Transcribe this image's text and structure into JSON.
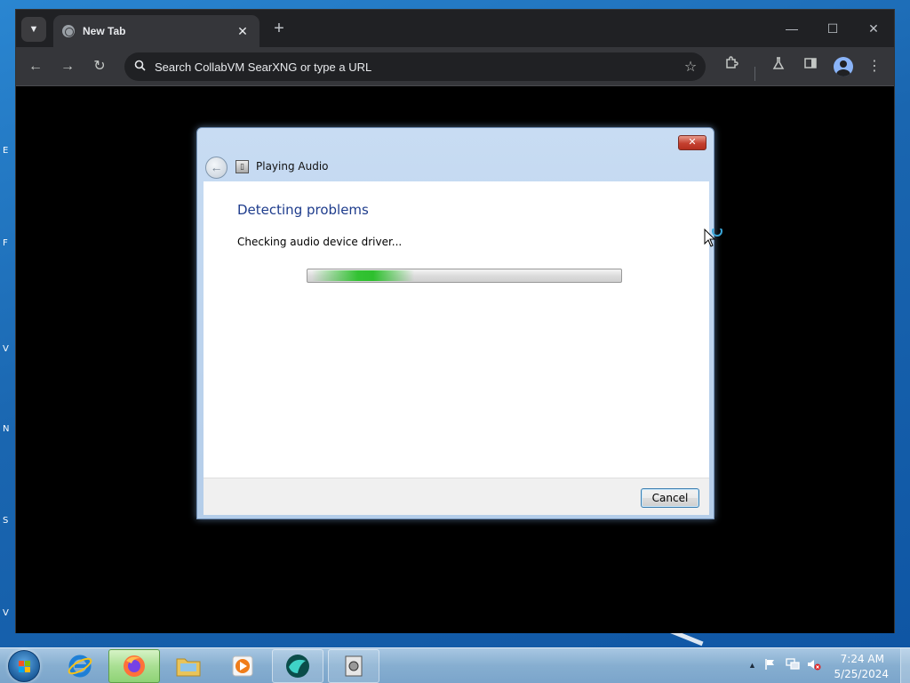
{
  "browser": {
    "tab": {
      "title": "New Tab",
      "close_glyph": "✕"
    },
    "new_tab_glyph": "+",
    "window_controls": {
      "minimize": "—",
      "maximize": "☐",
      "close": "✕"
    },
    "nav": {
      "back": "←",
      "forward": "→",
      "reload": "↻"
    },
    "omnibox": {
      "placeholder": "Search CollabVM SearXNG or type a URL",
      "value": ""
    },
    "toolbar_icons": [
      "extensions-icon",
      "labs-icon",
      "side-panel-icon",
      "profile-icon",
      "menu-icon"
    ]
  },
  "dialog": {
    "title": "Playing Audio",
    "close_glyph": "✕",
    "heading": "Detecting problems",
    "status": "Checking audio device driver...",
    "progress": {
      "mode": "indeterminate",
      "color": "#33c233"
    },
    "cancel_label": "Cancel"
  },
  "desktop": {
    "edge_letters": [
      "E",
      "F",
      "V",
      "N",
      "S",
      "V"
    ]
  },
  "taskbar": {
    "apps": [
      {
        "name": "internet-explorer",
        "state": "pinned"
      },
      {
        "name": "firefox",
        "state": "active"
      },
      {
        "name": "file-explorer",
        "state": "pinned"
      },
      {
        "name": "media-player",
        "state": "pinned"
      },
      {
        "name": "browser",
        "state": "open"
      },
      {
        "name": "troubleshooter",
        "state": "open"
      }
    ],
    "tray": {
      "show_hidden": "▲",
      "time": "7:24 AM",
      "date": "5/25/2024"
    }
  },
  "colors": {
    "browser_chrome": "#202124",
    "toolbar": "#35363a",
    "dialog_heading": "#1e3c8c",
    "dialog_frame": "#b4cde9",
    "desktop": "#1a66b0"
  }
}
